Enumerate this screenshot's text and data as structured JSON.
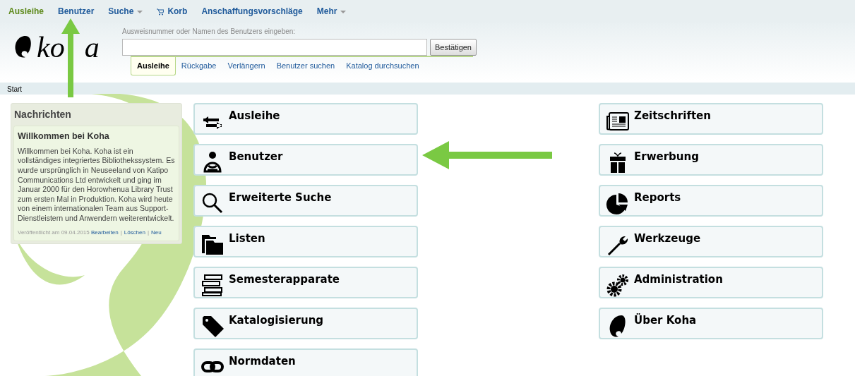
{
  "top_nav": [
    {
      "label": "Ausleihe",
      "selected": true,
      "dropdown": false,
      "kind": "link"
    },
    {
      "label": "Benutzer",
      "selected": false,
      "dropdown": false,
      "kind": "link"
    },
    {
      "label": "Suche",
      "selected": false,
      "dropdown": true,
      "kind": "link"
    },
    {
      "label": "Korb",
      "selected": false,
      "dropdown": false,
      "kind": "cart"
    },
    {
      "label": "Anschaffungsvorschläge",
      "selected": false,
      "dropdown": false,
      "kind": "link"
    },
    {
      "label": "Mehr",
      "selected": false,
      "dropdown": true,
      "kind": "link"
    }
  ],
  "logo_text": [
    "ko",
    "a"
  ],
  "search": {
    "label": "Ausweisnummer oder Namen des Benutzers eingeben:",
    "button": "Bestätigen"
  },
  "search_tabs": [
    {
      "label": "Ausleihe",
      "selected": true
    },
    {
      "label": "Rückgabe",
      "selected": false
    },
    {
      "label": "Verlängern",
      "selected": false
    },
    {
      "label": "Benutzer suchen",
      "selected": false
    },
    {
      "label": "Katalog durchsuchen",
      "selected": false
    }
  ],
  "breadcrumb": "Start",
  "news": {
    "title": "Nachrichten",
    "item_title": "Willkommen bei Koha",
    "body": "Willkommen bei Koha. Koha ist ein vollständiges integriertes Bibliothekssystem. Es wurde ursprünglich in Neuseeland von Katipo Communications Ltd entwickelt und ging im Januar 2000 für den Horowhenua Library Trust zum ersten Mal in Produktion. Koha wird heute von einem internationalen Team aus Support-Dienstleistern und Anwendern weiterentwickelt.",
    "posted": "Veröffentlicht am 09.04.2015",
    "actions": [
      "Bearbeiten",
      "Löschen",
      "Neu"
    ],
    "separator": "|"
  },
  "modules_left": [
    {
      "label": "Ausleihe",
      "kind": "transfer"
    },
    {
      "label": "Benutzer",
      "kind": "person"
    },
    {
      "label": "Erweiterte Suche",
      "kind": "search"
    },
    {
      "label": "Listen",
      "kind": "folder"
    },
    {
      "label": "Semesterapparate",
      "kind": "books"
    },
    {
      "label": "Katalogisierung",
      "kind": "tag"
    },
    {
      "label": "Normdaten",
      "kind": "link"
    }
  ],
  "modules_right": [
    {
      "label": "Zeitschriften",
      "kind": "newspaper"
    },
    {
      "label": "Erwerbung",
      "kind": "gift"
    },
    {
      "label": "Reports",
      "kind": "pie"
    },
    {
      "label": "Werkzeuge",
      "kind": "wrench"
    },
    {
      "label": "Administration",
      "kind": "gears"
    },
    {
      "label": "Über Koha",
      "kind": "koha"
    }
  ]
}
